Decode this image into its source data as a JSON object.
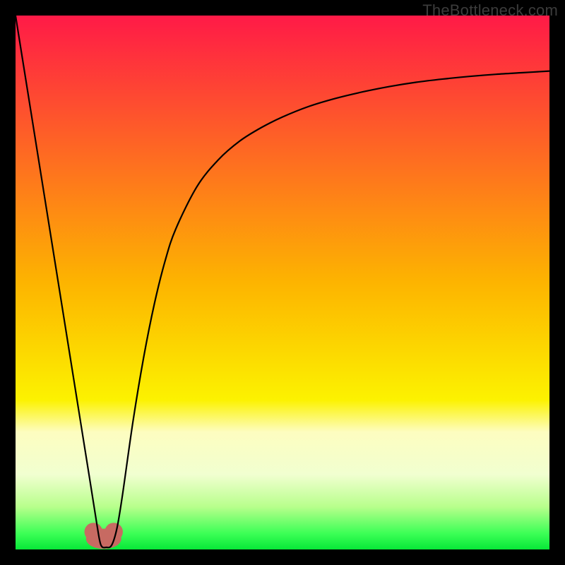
{
  "watermark": "TheBottleneck.com",
  "chart_data": {
    "type": "line",
    "title": "",
    "xlabel": "",
    "ylabel": "",
    "xlim": [
      0,
      100
    ],
    "ylim": [
      0,
      100
    ],
    "background_gradient": {
      "stops": [
        {
          "offset": 0.0,
          "color": "#ff1a47"
        },
        {
          "offset": 0.5,
          "color": "#fdb400"
        },
        {
          "offset": 0.72,
          "color": "#fcf200"
        },
        {
          "offset": 0.78,
          "color": "#fdfdc0"
        },
        {
          "offset": 0.86,
          "color": "#f1ffd0"
        },
        {
          "offset": 0.92,
          "color": "#b8ff8c"
        },
        {
          "offset": 0.97,
          "color": "#3cff56"
        },
        {
          "offset": 1.0,
          "color": "#07e838"
        }
      ]
    },
    "series": [
      {
        "name": "bottleneck-curve",
        "color": "#000000",
        "width": 2.2,
        "x": [
          0,
          4,
          8,
          12,
          14,
          15.3,
          16,
          17,
          18,
          19,
          20,
          22,
          24,
          26,
          28,
          30,
          34,
          38,
          42,
          46,
          50,
          55,
          60,
          65,
          70,
          75,
          80,
          85,
          90,
          95,
          100
        ],
        "values": [
          100,
          75,
          50,
          25,
          12.5,
          4.3,
          0.8,
          0.4,
          0.8,
          4.0,
          10,
          24,
          36,
          46,
          54,
          60,
          68,
          73,
          76.5,
          79,
          81,
          83,
          84.5,
          85.7,
          86.7,
          87.5,
          88.1,
          88.6,
          89.0,
          89.3,
          89.6
        ]
      }
    ],
    "valley_marker": {
      "color": "#c76a62",
      "cx": 16.5,
      "cy": 2.0,
      "rx": 3.3,
      "ry": 1.9,
      "lobe_r": 1.7,
      "lobe_dx": 1.9,
      "lobe_dy": 1.3
    }
  }
}
